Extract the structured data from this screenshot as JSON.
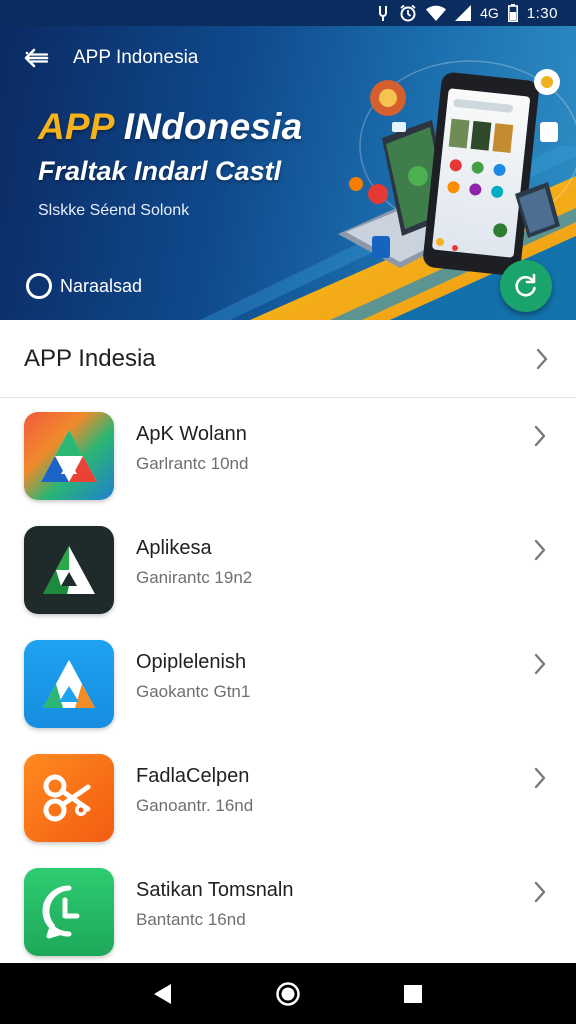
{
  "status_bar": {
    "time": "1:30",
    "battery_text": "4G",
    "icons": [
      "usb-icon",
      "alarm-icon",
      "wifi-icon",
      "signal-icon",
      "battery-icon"
    ]
  },
  "hero": {
    "topbar_title": "APP Indonesia",
    "title_accent": "APP",
    "title_rest": " INdonesia",
    "subtitle": "Fraltak Indarl Castl",
    "tagline": "Slskke Séend  Solonk",
    "status_label": "Naraalsad",
    "colors": {
      "accent": "#f6b21b",
      "fab": "#1aa36a",
      "banner_dark": "#0b2a63"
    }
  },
  "section": {
    "title": "APP Indesia"
  },
  "apps": [
    {
      "name": "ApK Wolann",
      "sub": "Garlrantc 10nd",
      "icon": "triangle-logo-multicolor-icon"
    },
    {
      "name": "Aplikesa",
      "sub": "Ganirantc 19n2",
      "icon": "triangle-logo-dark-icon"
    },
    {
      "name": "Opiplelenish",
      "sub": "Gaokantc Gtn1",
      "icon": "triangle-logo-blue-icon"
    },
    {
      "name": "FadlaCelpen",
      "sub": "Ganoantr. 16nd",
      "icon": "tools-icon"
    },
    {
      "name": "Satikan Tomsnaln",
      "sub": "Bantantc 16nd",
      "icon": "chat-bubble-icon"
    }
  ],
  "nav": {
    "icons": [
      "back-triangle-icon",
      "home-circle-icon",
      "recents-square-icon"
    ]
  }
}
